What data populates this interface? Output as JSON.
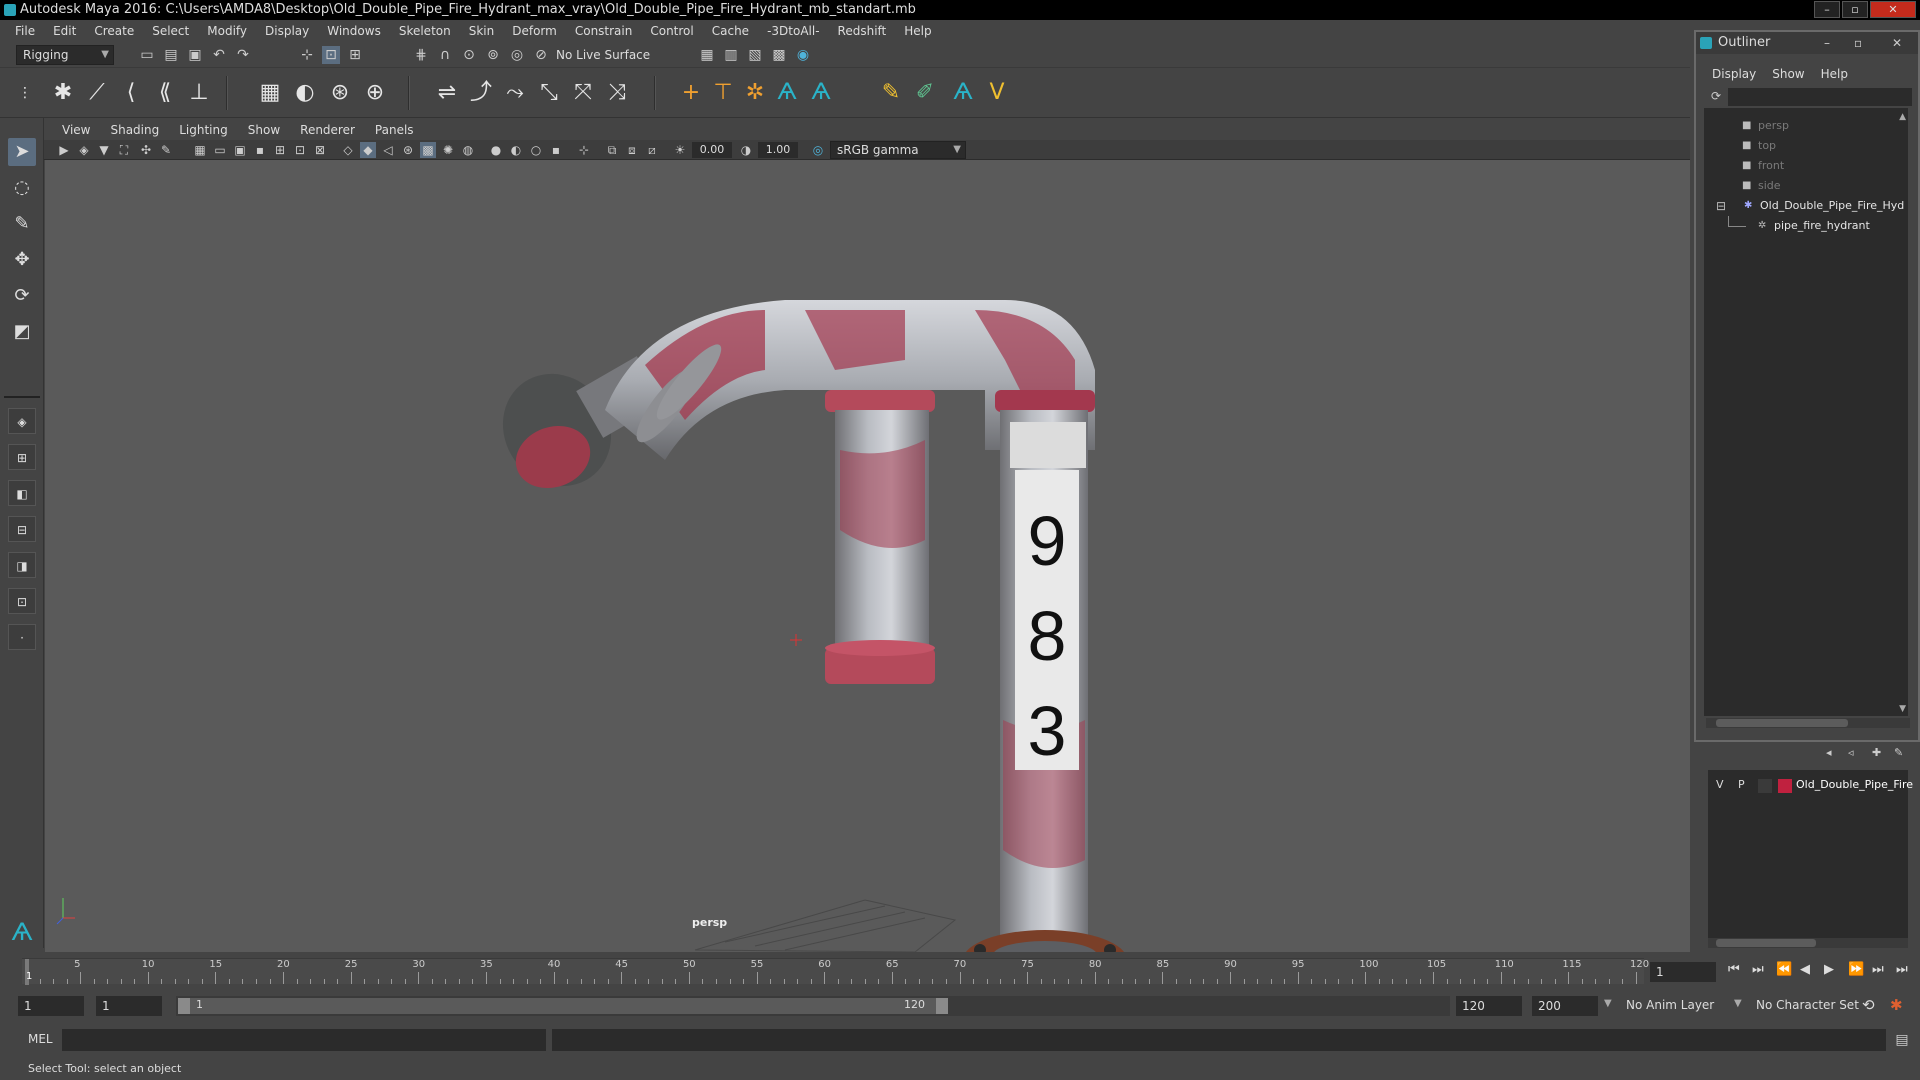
{
  "window": {
    "title": "Autodesk Maya 2016: C:\\Users\\AMDA8\\Desktop\\Old_Double_Pipe_Fire_Hydrant_max_vray\\Old_Double_Pipe_Fire_Hydrant_mb_standart.mb"
  },
  "menubar": [
    "File",
    "Edit",
    "Create",
    "Select",
    "Modify",
    "Display",
    "Windows",
    "Skeleton",
    "Skin",
    "Deform",
    "Constrain",
    "Control",
    "Cache",
    "-3DtoAll-",
    "Redshift",
    "Help"
  ],
  "status_line": {
    "menu_set": "Rigging",
    "live_surface": "No Live Surface"
  },
  "panel": {
    "menu": [
      "View",
      "Shading",
      "Lighting",
      "Show",
      "Renderer",
      "Panels"
    ],
    "exposure": "0.00",
    "gamma": "1.00",
    "color_space": "sRGB gamma",
    "camera_label": "persp"
  },
  "model": {
    "number_plate": [
      "9",
      "8",
      "3"
    ]
  },
  "outliner": {
    "title": "Outliner",
    "menu": [
      "Display",
      "Show",
      "Help"
    ],
    "items": [
      {
        "label": "persp",
        "type": "camera-icon",
        "dim": true
      },
      {
        "label": "top",
        "type": "camera-icon",
        "dim": true
      },
      {
        "label": "front",
        "type": "camera-icon",
        "dim": true
      },
      {
        "label": "side",
        "type": "camera-icon",
        "dim": true
      },
      {
        "label": "Old_Double_Pipe_Fire_Hyd",
        "type": "group-icon",
        "dim": false
      },
      {
        "label": "pipe_fire_hydrant",
        "type": "mesh-icon",
        "dim": false
      }
    ]
  },
  "layers": {
    "v": "V",
    "p": "P",
    "name": "Old_Double_Pipe_Fire",
    "color": "#c0213f"
  },
  "timeline": {
    "ticks": [
      "5",
      "10",
      "15",
      "20",
      "25",
      "30",
      "35",
      "40",
      "45",
      "50",
      "55",
      "60",
      "65",
      "70",
      "75",
      "80",
      "85",
      "90",
      "95",
      "100",
      "105",
      "110",
      "115",
      "120"
    ],
    "current_frame_marker": "1",
    "current_frame_field": "1"
  },
  "range": {
    "start": "1",
    "playback_start": "1",
    "slider_start": "1",
    "slider_end": "120",
    "playback_end": "120",
    "end": "200",
    "anim_layer": "No Anim Layer",
    "character_set": "No Character Set"
  },
  "command_line": {
    "language": "MEL"
  },
  "help_line": "Select Tool: select an object"
}
